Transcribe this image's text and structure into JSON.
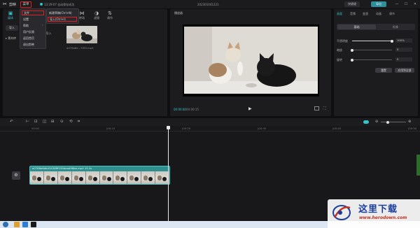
{
  "titlebar": {
    "app_name": "剪映",
    "menu_label": "菜单",
    "save_status": "13:29:07 自动保存成功",
    "project_name": "202301041221",
    "shortcut_label": "快捷键",
    "export_label": "导出",
    "minimize": "—",
    "maximize": "☐",
    "close": "✕"
  },
  "menu": {
    "items": [
      "文件",
      "设置",
      "帮助",
      "用户反馈",
      "返回首页",
      "退出剪映"
    ]
  },
  "submenu": {
    "items": [
      "新建草稿(Ctrl+N)",
      "导入(Ctrl+I)"
    ]
  },
  "left_tabs": [
    {
      "label": "媒体",
      "icon": "▣"
    },
    {
      "label": "音频",
      "icon": "♪"
    },
    {
      "label": "文本",
      "icon": "T"
    },
    {
      "label": "贴纸",
      "icon": "☺"
    },
    {
      "label": "特效",
      "icon": "✦"
    },
    {
      "label": "转场",
      "icon": "⋈"
    },
    {
      "label": "滤镜",
      "icon": "◑"
    },
    {
      "label": "调节",
      "icon": "⇅"
    }
  ],
  "media": {
    "import_label": "导入",
    "local_label": "素材库",
    "import_hint": "导入",
    "thumb_name": "a076a8e...33f4.mp4"
  },
  "player": {
    "title": "播放器",
    "time_current": "00:00:00",
    "time_total": "00:00:15",
    "play_icon": "▶",
    "ratio_label": "比例",
    "fullscreen_icon": "⛶"
  },
  "right_panel": {
    "tabs": [
      "画面",
      "音频",
      "变速",
      "动画",
      "调节"
    ],
    "segments": [
      "基础",
      "抠像"
    ],
    "props": [
      {
        "label": "不透明度",
        "value": "100%",
        "level": 1.0
      },
      {
        "label": "缩放",
        "value": "0",
        "level": 0.0
      },
      {
        "label": "旋转",
        "value": "0",
        "level": 0.0
      }
    ],
    "reset_label": "重置",
    "apply_all_label": "应用到全部"
  },
  "timeline": {
    "ruler_labels": [
      "00:00",
      "|00:10",
      "|00:20",
      "|00:30",
      "|00:40",
      "|00:50"
    ],
    "clip_label": "a0766e6db43436fff159dead96be.mp4  15.2s",
    "tools": [
      "↶",
      "⊢",
      "⊡",
      "◫",
      "⊟",
      "⊙",
      "⟲",
      "⌗"
    ],
    "track_cover_icon": "⚙"
  },
  "watermark": {
    "title": "这里下载",
    "url": "www.herodown.com"
  },
  "colors": {
    "accent": "#37c2c8",
    "highlight": "#e02020",
    "clip": "#2e8f8f"
  }
}
